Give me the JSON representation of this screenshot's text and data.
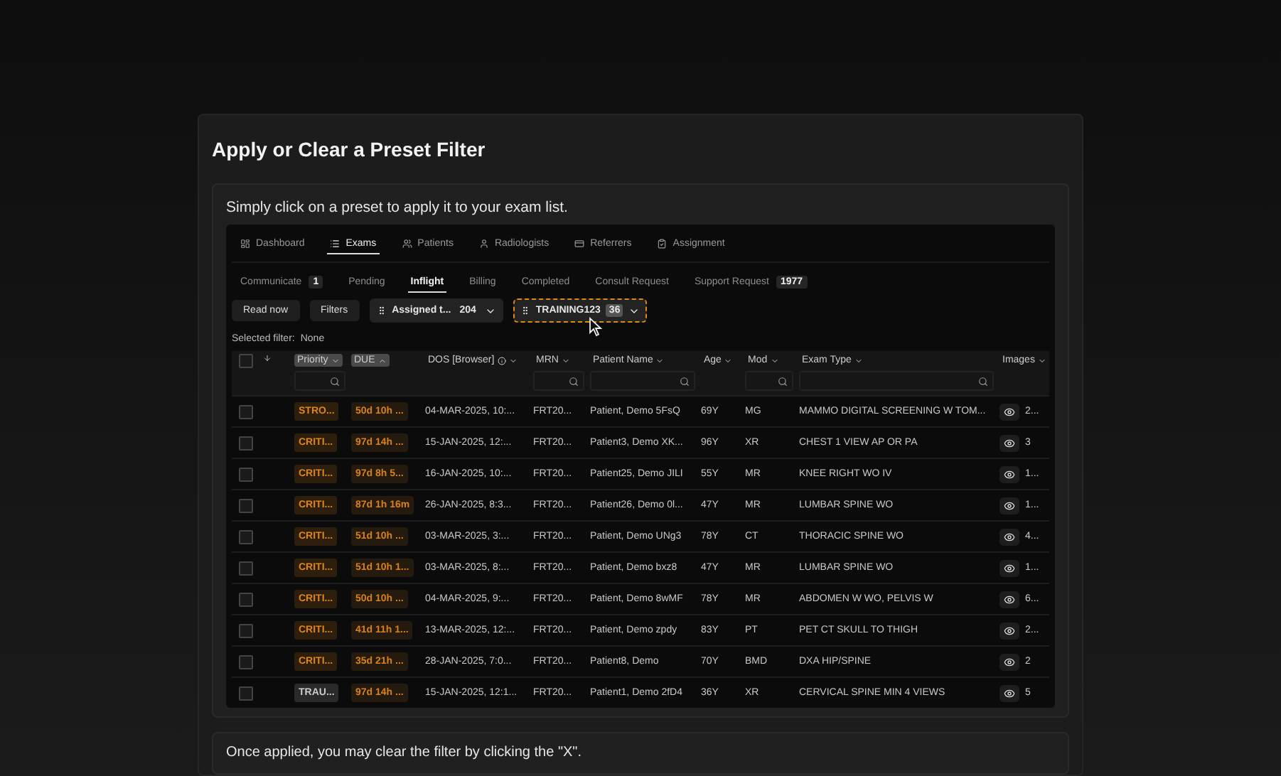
{
  "title": "Apply or Clear a Preset Filter",
  "intro": "Simply click on a preset to apply it to your exam list.",
  "nav_tabs": [
    {
      "label": "Dashboard",
      "selected": false
    },
    {
      "label": "Exams",
      "selected": true
    },
    {
      "label": "Patients",
      "selected": false
    },
    {
      "label": "Radiologists",
      "selected": false
    },
    {
      "label": "Referrers",
      "selected": false
    },
    {
      "label": "Assignment",
      "selected": false
    }
  ],
  "select_all": {
    "checked": false
  },
  "sub_tabs": [
    {
      "label": "Communicate",
      "count": "1",
      "selected": false
    },
    {
      "label": "Pending",
      "selected": false
    },
    {
      "label": "Inflight",
      "selected": true
    },
    {
      "label": "Billing",
      "selected": false
    },
    {
      "label": "Completed",
      "selected": false
    },
    {
      "label": "Consult Request",
      "selected": false
    },
    {
      "label": "Support Request",
      "count": "1977",
      "selected": false
    }
  ],
  "toolbar_buttons": [
    "Read now",
    "Filters"
  ],
  "presets": [
    {
      "label": "Assigned t...",
      "count": "204",
      "selected": false
    },
    {
      "label": "TRAINING123",
      "count": "36",
      "selected": true
    }
  ],
  "selected_filter": {
    "label": "Selected filter:",
    "value": "None"
  },
  "columns": [
    {
      "label": "Priority",
      "sorted_ascending": false,
      "filter": true,
      "highlighted": true
    },
    {
      "label": "DUE",
      "sorted_ascending": true,
      "filter": false,
      "highlighted": true
    },
    {
      "label": "DOS [Browser]",
      "sorted_ascending": false,
      "filter": false,
      "highlighted": false,
      "info": true
    },
    {
      "label": "MRN",
      "sorted_ascending": false,
      "filter": true,
      "highlighted": false
    },
    {
      "label": "Patient Name",
      "sorted_ascending": false,
      "filter": true,
      "highlighted": false
    },
    {
      "label": "Age",
      "sorted_ascending": false,
      "filter": false,
      "highlighted": false
    },
    {
      "label": "Mod",
      "sorted_ascending": false,
      "filter": true,
      "highlighted": false
    },
    {
      "label": "Exam Type",
      "sorted_ascending": false,
      "filter": true,
      "highlighted": false
    },
    {
      "label": "Images",
      "sorted_ascending": false,
      "filter": false,
      "highlighted": false
    }
  ],
  "rows": [
    {
      "checked": false,
      "priority": "STRO...",
      "critical": true,
      "due": "50d 10h ...",
      "dos": "04-MAR-2025, 10:...",
      "mrn": "FRT20...",
      "patient": "Patient, Demo 5FsQ",
      "age": "69Y",
      "mod": "MG",
      "exam": "MAMMO DIGITAL SCREENING W TOM...",
      "images": "2..."
    },
    {
      "checked": false,
      "priority": "CRITI...",
      "critical": true,
      "due": "97d 14h ...",
      "dos": "15-JAN-2025, 12:...",
      "mrn": "FRT20...",
      "patient": "Patient3, Demo XK...",
      "age": "96Y",
      "mod": "XR",
      "exam": "CHEST 1 VIEW AP OR PA",
      "images": "3"
    },
    {
      "checked": false,
      "priority": "CRITI...",
      "critical": true,
      "due": "97d 8h 5...",
      "dos": "16-JAN-2025, 10:...",
      "mrn": "FRT20...",
      "patient": "Patient25, Demo JILI",
      "age": "55Y",
      "mod": "MR",
      "exam": "KNEE RIGHT WO IV",
      "images": "1..."
    },
    {
      "checked": false,
      "priority": "CRITI...",
      "critical": true,
      "due": "87d 1h 16m",
      "dos": "26-JAN-2025, 8:3...",
      "mrn": "FRT20...",
      "patient": "Patient26, Demo 0l...",
      "age": "47Y",
      "mod": "MR",
      "exam": "LUMBAR SPINE WO",
      "images": "1..."
    },
    {
      "checked": false,
      "priority": "CRITI...",
      "critical": true,
      "due": "51d 10h ...",
      "dos": "03-MAR-2025, 3:...",
      "mrn": "FRT20...",
      "patient": "Patient, Demo UNg3",
      "age": "78Y",
      "mod": "CT",
      "exam": "THORACIC SPINE WO",
      "images": "4..."
    },
    {
      "checked": false,
      "priority": "CRITI...",
      "critical": true,
      "due": "51d 10h 1...",
      "dos": "03-MAR-2025, 8:...",
      "mrn": "FRT20...",
      "patient": "Patient, Demo bxz8",
      "age": "47Y",
      "mod": "MR",
      "exam": "LUMBAR SPINE WO",
      "images": "1..."
    },
    {
      "checked": false,
      "priority": "CRITI...",
      "critical": true,
      "due": "50d 10h ...",
      "dos": "04-MAR-2025, 9:...",
      "mrn": "FRT20...",
      "patient": "Patient, Demo 8wMF",
      "age": "78Y",
      "mod": "MR",
      "exam": "ABDOMEN W WO, PELVIS W",
      "images": "6..."
    },
    {
      "checked": false,
      "priority": "CRITI...",
      "critical": true,
      "due": "41d 11h 1...",
      "dos": "13-MAR-2025, 12:...",
      "mrn": "FRT20...",
      "patient": "Patient, Demo zpdy",
      "age": "83Y",
      "mod": "PT",
      "exam": "PET CT SKULL TO THIGH",
      "images": "2..."
    },
    {
      "checked": false,
      "priority": "CRITI...",
      "critical": true,
      "due": "35d 21h ...",
      "dos": "28-JAN-2025, 7:0...",
      "mrn": "FRT20...",
      "patient": "Patient8, Demo",
      "age": "70Y",
      "mod": "BMD",
      "exam": "DXA HIP/SPINE",
      "images": "2"
    },
    {
      "checked": false,
      "priority": "TRAU...",
      "critical": false,
      "due": "97d 14h ...",
      "dos": "15-JAN-2025, 12:1...",
      "mrn": "FRT20...",
      "patient": "Patient1, Demo 2fD4",
      "age": "36Y",
      "mod": "XR",
      "exam": "CERVICAL SPINE MIN 4 VIEWS",
      "images": "5"
    }
  ],
  "outro": "Once applied, you may clear the filter by clicking the \"X\"."
}
